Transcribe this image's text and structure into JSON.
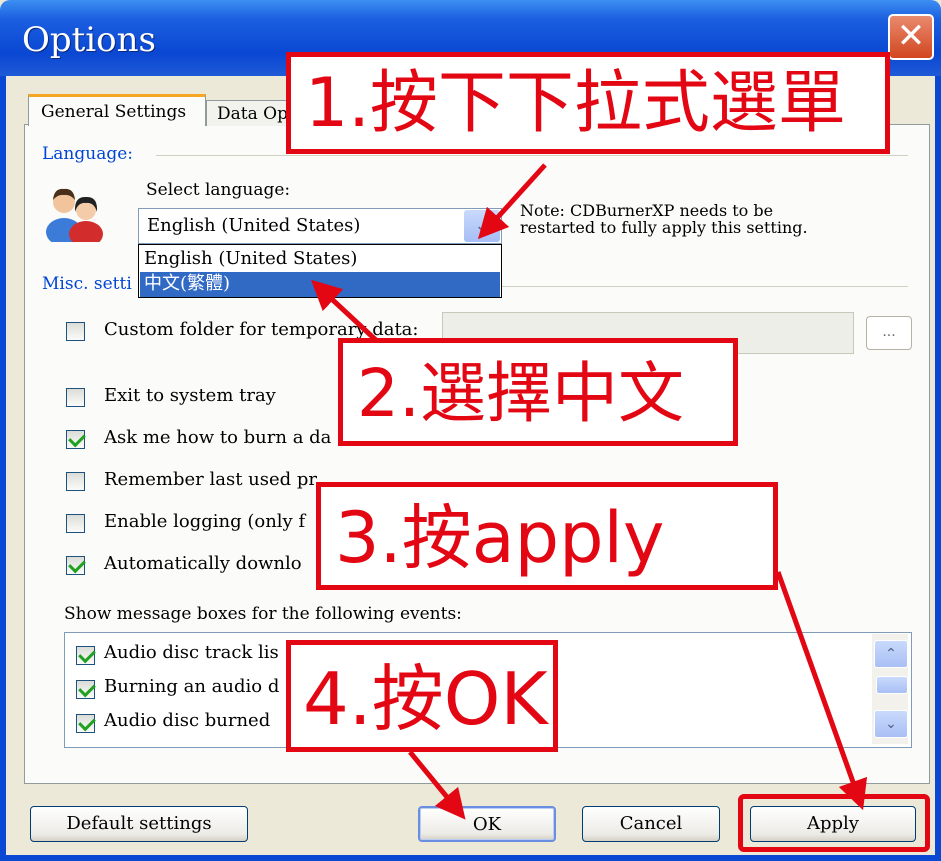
{
  "window": {
    "title": "Options",
    "close_label": "✕"
  },
  "tabs": {
    "general": "General Settings",
    "data": "Data Op"
  },
  "language": {
    "group_label": "Language:",
    "select_label": "Select language:",
    "selected_value": "English (United States)",
    "options": [
      "English (United States)",
      "中文(繁體)"
    ],
    "highlighted_option": "中文(繁體)",
    "note_line1": "Note: CDBurnerXP needs to be",
    "note_line2": "restarted to fully apply this setting."
  },
  "misc": {
    "group_label": "Misc. setti",
    "custom_folder": {
      "label": "Custom folder for temporary data:",
      "checked": false
    },
    "browse_label": "...",
    "exit_tray": {
      "label": "Exit to system tray",
      "checked": false
    },
    "ask_burn": {
      "label": "Ask me how to burn a da",
      "checked": true
    },
    "remember_project": {
      "label": "Remember last used pr",
      "checked": false
    },
    "enable_logging": {
      "label": "Enable logging (only f",
      "checked": false
    },
    "auto_download": {
      "label": "Automatically downlo",
      "checked": true
    }
  },
  "events": {
    "label": "Show message boxes for the following events:",
    "items": [
      {
        "label": "Audio disc track lis",
        "checked": true
      },
      {
        "label": "Burning an audio d",
        "checked": true
      },
      {
        "label": "Audio disc burned",
        "checked": true
      }
    ]
  },
  "buttons": {
    "default": "Default settings",
    "ok": "OK",
    "cancel": "Cancel",
    "apply": "Apply"
  },
  "annotations": {
    "step1": "1.按下下拉式選單",
    "step2": "2.選擇中文",
    "step3": "3.按apply",
    "step4": "4.按OK"
  },
  "colors": {
    "annotation_red": "#e30613",
    "selection_blue": "#316ac5",
    "titlebar_blue": "#0a47d3"
  }
}
